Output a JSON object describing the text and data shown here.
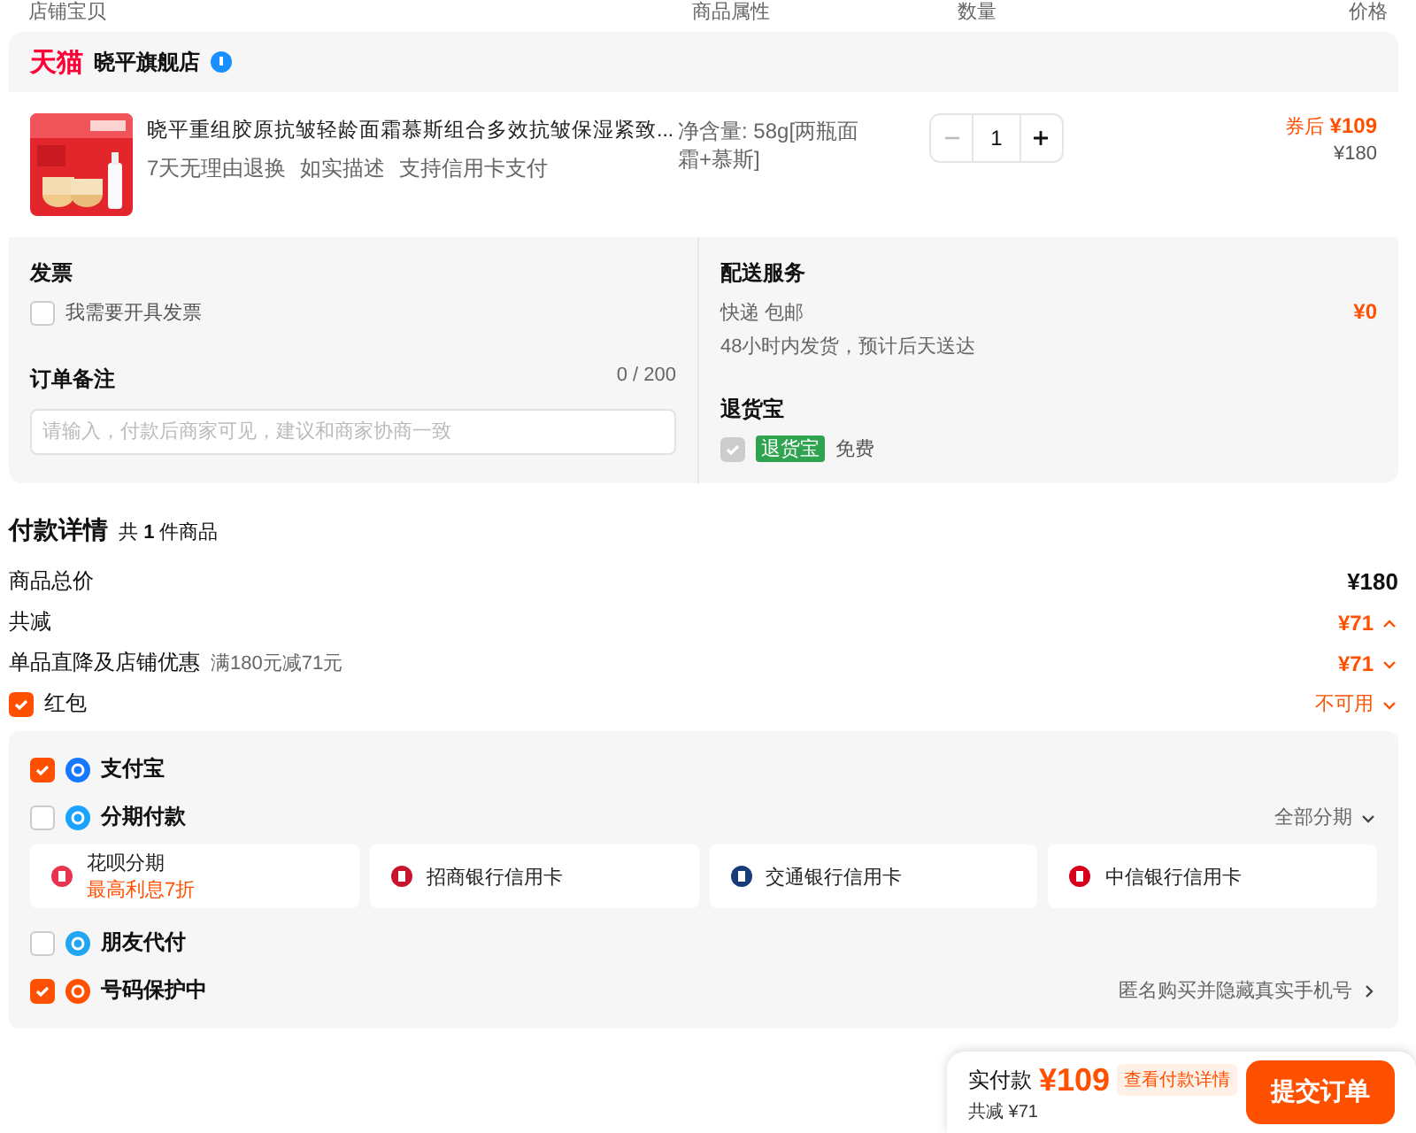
{
  "columns": [
    "店铺宝贝",
    "商品属性",
    "数量",
    "价格"
  ],
  "shop": {
    "brand": "天猫",
    "name": "晓平旗舰店"
  },
  "item": {
    "title": "晓平重组胶原抗皱轻龄面霜慕斯组合多效抗皱保湿紧致...",
    "services": [
      "7天无理由退换",
      "如实描述",
      "支持信用卡支付"
    ],
    "attribute": "净含量: 58g[两瓶面霜+慕斯]",
    "quantity": "1",
    "coupon_label": "券后",
    "price": "¥109",
    "original_price": "¥180"
  },
  "invoice": {
    "title": "发票",
    "label": "我需要开具发票",
    "checked": false
  },
  "note": {
    "title": "订单备注",
    "count": "0 / 200",
    "placeholder": "请输入，付款后商家可见，建议和商家协商一致"
  },
  "delivery": {
    "title": "配送服务",
    "method": "快递 包邮",
    "eta": "48小时内发货，预计后天送达",
    "price": "¥0"
  },
  "return_insurance": {
    "title": "退货宝",
    "checked": true,
    "tag": "退货宝",
    "note": "免费"
  },
  "payment": {
    "title": "付款详情",
    "count_text": "共 **1** 件商品",
    "rows": [
      {
        "kind": "total",
        "label": "商品总价",
        "value": "¥180"
      },
      {
        "kind": "discount",
        "label": "共减",
        "value": "¥71",
        "expanded": true
      },
      {
        "kind": "discount",
        "label": "单品直降及店铺优惠",
        "detail": "满180元减71元",
        "value": "¥71",
        "expanded": false
      }
    ],
    "red_packet": {
      "label": "红包",
      "checked": true,
      "value": "不可用",
      "expanded": false
    }
  },
  "methods": [
    {
      "kind": "alipay",
      "label": "支付宝",
      "checked": true
    },
    {
      "kind": "installment",
      "label": "分期付款",
      "checked": false,
      "link": "全部分期",
      "options": [
        {
          "kind": "huabei",
          "label": "花呗分期",
          "note": "最高利息7折"
        },
        {
          "kind": "cmb",
          "label": "招商银行信用卡"
        },
        {
          "kind": "bocom",
          "label": "交通银行信用卡"
        },
        {
          "kind": "citic",
          "label": "中信银行信用卡"
        }
      ]
    },
    {
      "kind": "friend",
      "label": "朋友代付",
      "checked": false
    },
    {
      "kind": "privacy",
      "label": "号码保护中",
      "checked": true,
      "link": "匿名购买并隐藏真实手机号"
    }
  ],
  "footer": {
    "label": "实付款",
    "amount": "¥109",
    "details_button": "查看付款详情",
    "saved": "共减 ¥71",
    "submit": "提交订单"
  }
}
